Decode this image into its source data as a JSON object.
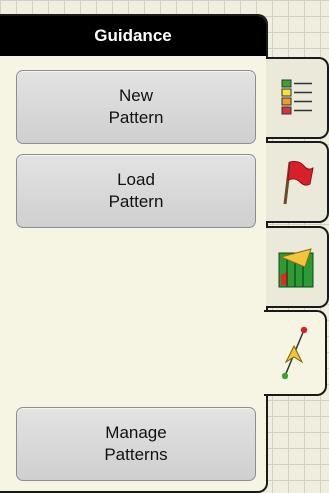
{
  "panel": {
    "title": "Guidance",
    "buttons": {
      "new_pattern": [
        "New",
        "Pattern"
      ],
      "load_pattern": [
        "Load",
        "Pattern"
      ],
      "manage_patterns": [
        "Manage",
        "Patterns"
      ]
    }
  },
  "tabs": [
    {
      "icon": "list-overview-icon",
      "active": false
    },
    {
      "icon": "red-flag-icon",
      "active": false
    },
    {
      "icon": "coverage-map-icon",
      "active": false
    },
    {
      "icon": "guidance-arrow-icon",
      "active": true
    }
  ],
  "colors": {
    "header_bg": "#000000",
    "panel_bg": "#f6f5e4",
    "grid_bg": "#f0efdf",
    "button_bg": "#d8d8d8"
  }
}
